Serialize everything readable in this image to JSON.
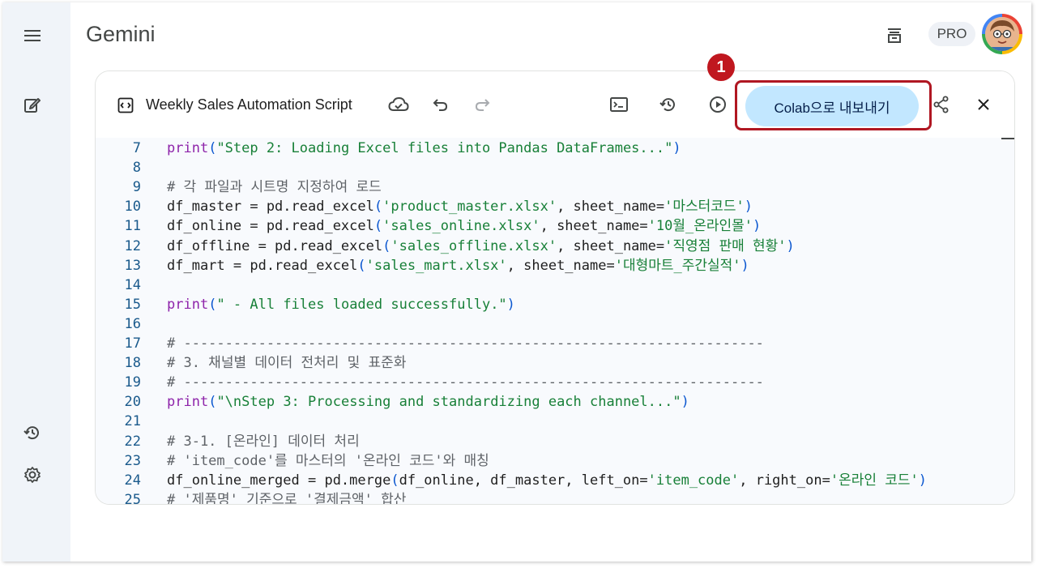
{
  "app": {
    "title": "Gemini",
    "pro_label": "PRO"
  },
  "left_rail": {
    "icons": [
      "menu-icon",
      "new-chat-icon",
      "history-icon",
      "settings-icon"
    ]
  },
  "top_icons": [
    "clear-history-icon"
  ],
  "panel": {
    "doc_title": "Weekly Sales Automation Script",
    "export_label": "Colab으로 내보내기",
    "header_icons": [
      "code-doc-icon",
      "cloud-sync-icon",
      "undo-icon",
      "redo-icon",
      "terminal-icon",
      "version-history-icon",
      "run-icon",
      "share-icon",
      "close-icon"
    ]
  },
  "annotation": {
    "step_number": "1"
  },
  "code_lines": [
    {
      "num": "7",
      "text": "print(\"Step 2: Loading Excel files into Pandas DataFrames...\")"
    },
    {
      "num": "8",
      "text": ""
    },
    {
      "num": "9",
      "text": "# 각 파일과 시트명 지정하여 로드"
    },
    {
      "num": "10",
      "text": "df_master = pd.read_excel('product_master.xlsx', sheet_name='마스터코드')"
    },
    {
      "num": "11",
      "text": "df_online = pd.read_excel('sales_online.xlsx', sheet_name='10월_온라인몰')"
    },
    {
      "num": "12",
      "text": "df_offline = pd.read_excel('sales_offline.xlsx', sheet_name='직영점 판매 현황')"
    },
    {
      "num": "13",
      "text": "df_mart = pd.read_excel('sales_mart.xlsx', sheet_name='대형마트_주간실적')"
    },
    {
      "num": "14",
      "text": ""
    },
    {
      "num": "15",
      "text": "print(\" - All files loaded successfully.\")"
    },
    {
      "num": "16",
      "text": ""
    },
    {
      "num": "17",
      "text": "# ----------------------------------------------------------------------"
    },
    {
      "num": "18",
      "text": "# 3. 채널별 데이터 전처리 및 표준화"
    },
    {
      "num": "19",
      "text": "# ----------------------------------------------------------------------"
    },
    {
      "num": "20",
      "text": "print(\"\\nStep 3: Processing and standardizing each channel...\")"
    },
    {
      "num": "21",
      "text": ""
    },
    {
      "num": "22",
      "text": "# 3-1. [온라인] 데이터 처리"
    },
    {
      "num": "23",
      "text": "# 'item_code'를 마스터의 '온라인 코드'와 매칭"
    },
    {
      "num": "24",
      "text": "df_online_merged = pd.merge(df_online, df_master, left_on='item_code', right_on='온라인 코드')"
    },
    {
      "num": "25",
      "text": "# '제품명' 기준으로 '결제금액' 합산"
    }
  ]
}
